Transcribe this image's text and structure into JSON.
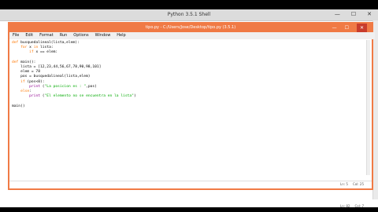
{
  "shell": {
    "title": "Python 3.5.1 Shell",
    "controls": {
      "minimize": "—",
      "maximize": "☐",
      "close": "✕"
    },
    "status": {
      "line": "Ln: 82",
      "col": "Col: 7"
    }
  },
  "editor": {
    "title": "tipo.py - C:/Users/Jose/Desktop/tipo.py (3.5.1)",
    "controls": {
      "minimize": "—",
      "maximize": "☐",
      "close": "✕"
    },
    "menu": [
      "File",
      "Edit",
      "Format",
      "Run",
      "Options",
      "Window",
      "Help"
    ],
    "status": {
      "line": "Ln: 5",
      "col": "Col: 25"
    },
    "code": {
      "l1_def": "def",
      "l1_rest": " busquedalineal(lista,elem):",
      "l2_for": "for",
      "l2_mid": " x ",
      "l2_in": "in",
      "l2_rest": " lista:",
      "l3_if": "if",
      "l3_rest": " x == elem:",
      "l4_def": "def",
      "l4_rest": " main():",
      "l5": "    lista = [12,23,44,56,67,78,90,98,101]",
      "l6": "    elem = 78",
      "l7": "    pos = busquedalineal(lista,elem)",
      "l8_if": "if",
      "l8_rest": " (pos<0):",
      "l9_print": "print",
      "l9_str": "\"La posicion es : \"",
      "l9_rest": ",pos)",
      "l10_else": "else",
      "l10_rest": ":",
      "l11_print": "print",
      "l11_str": "\"El elemento no se encuentra en la lista\"",
      "l11_rest": ")",
      "l12": "main()"
    }
  }
}
